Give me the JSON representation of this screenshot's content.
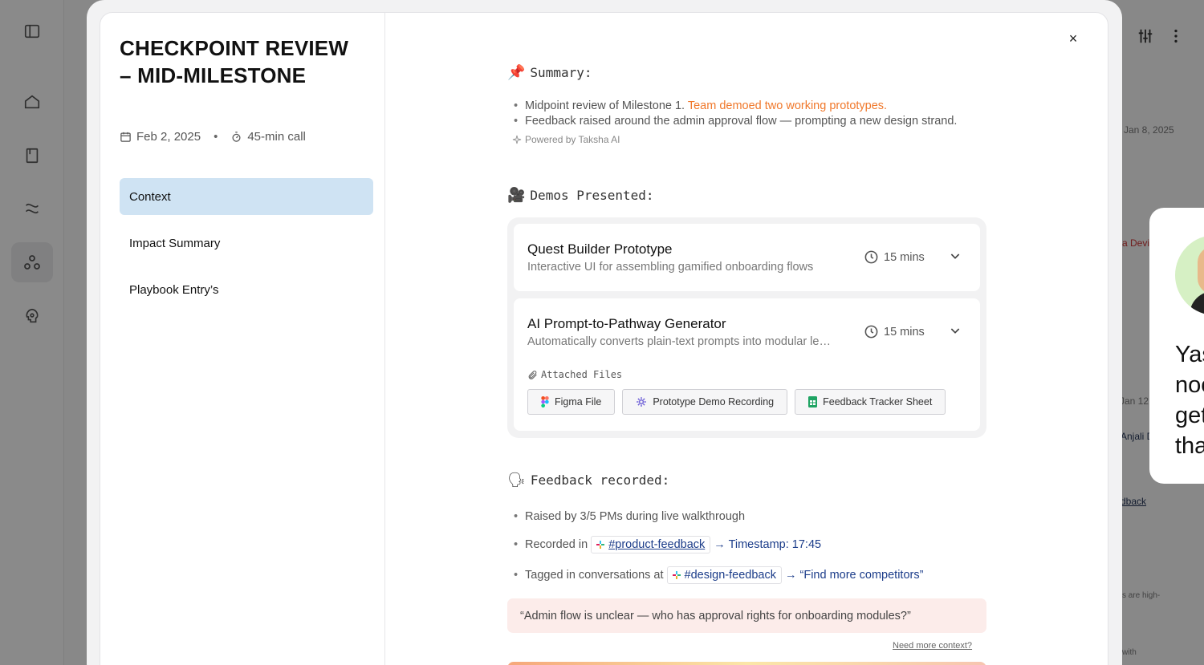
{
  "background": {
    "dates": [
      "Jan 8, 2025",
      "Jan 12,"
    ],
    "names": [
      "a Devi",
      "Anjali D"
    ],
    "snippets": [
      "dback",
      "s are high-",
      "with"
    ],
    "side_card_text": [
      "Yas",
      "noo",
      "get",
      "tha"
    ]
  },
  "modal": {
    "title": "CHECKPOINT REVIEW – MID-MILESTONE",
    "date": "Feb 2, 2025",
    "duration": "45-min call",
    "nav": [
      {
        "label": "Context",
        "active": true
      },
      {
        "label": "Impact Summary",
        "active": false
      },
      {
        "label": "Playbook Entry’s",
        "active": false
      }
    ],
    "close_label": "×"
  },
  "summary": {
    "heading": "Summary:",
    "emoji": "📌",
    "bullet1_prefix": "Midpoint review of Milestone 1. ",
    "bullet1_highlight": "Team demoed two working prototypes.",
    "bullet2": "Feedback raised around the admin approval flow — prompting a new design strand.",
    "powered_by": "Powered by Taksha AI"
  },
  "demos": {
    "heading": "Demos Presented:",
    "emoji": "🎥",
    "items": [
      {
        "title": "Quest Builder Prototype",
        "subtitle": "Interactive UI for assembling gamified onboarding flows",
        "time": "15 mins"
      },
      {
        "title": "AI Prompt-to-Pathway Generator",
        "subtitle": "Automatically converts plain-text prompts into modular learning pathways",
        "time": "15 mins"
      }
    ],
    "attached_label": "Attached Files",
    "files": [
      "Figma File",
      "Prototype Demo Recording",
      "Feedback Tracker Sheet"
    ]
  },
  "feedback": {
    "heading": "Feedback recorded:",
    "emoji": "🗣",
    "raised": "Raised by 3/5 PMs during live walkthrough",
    "recorded_prefix": "Recorded in",
    "recorded_channel": "#product-feedback",
    "recorded_link": "→ Timestamp: 17:45",
    "tagged_prefix": "Tagged in conversations at",
    "tagged_channel": "#design-feedback",
    "tagged_link": "→ “Find more competitors”",
    "quote": "“Admin flow is unclear — who has approval rights for onboarding modules?”",
    "need_more": "Need more context?"
  },
  "colors": {
    "highlight": "#f0782b",
    "active_nav": "#cfe3f3",
    "link": "#1c3d8a",
    "quote_bg": "#fcecea"
  }
}
